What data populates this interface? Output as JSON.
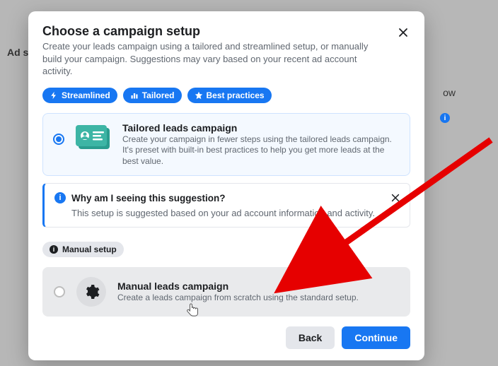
{
  "background": {
    "left_label": "Ad s",
    "right_fragment": "ow"
  },
  "modal": {
    "title": "Choose a campaign setup",
    "subtitle": "Create your leads campaign using a tailored and streamlined setup, or manually build your campaign. Suggestions may vary based on your recent ad account activity.",
    "pills": {
      "streamlined": "Streamlined",
      "tailored": "Tailored",
      "best_practices": "Best practices"
    },
    "option_tailored": {
      "title": "Tailored leads campaign",
      "desc": "Create your campaign in fewer steps using the tailored leads campaign. It's preset with built-in best practices to help you get more leads at the best value.",
      "selected": true
    },
    "info": {
      "title": "Why am I seeing this suggestion?",
      "body": "This setup is suggested based on your ad account information and activity."
    },
    "section_manual_label": "Manual setup",
    "option_manual": {
      "title": "Manual leads campaign",
      "desc": "Create a leads campaign from scratch using the standard setup.",
      "selected": false
    },
    "footer": {
      "back": "Back",
      "continue": "Continue"
    }
  },
  "colors": {
    "accent": "#1877f2",
    "arrow": "#e60000"
  }
}
